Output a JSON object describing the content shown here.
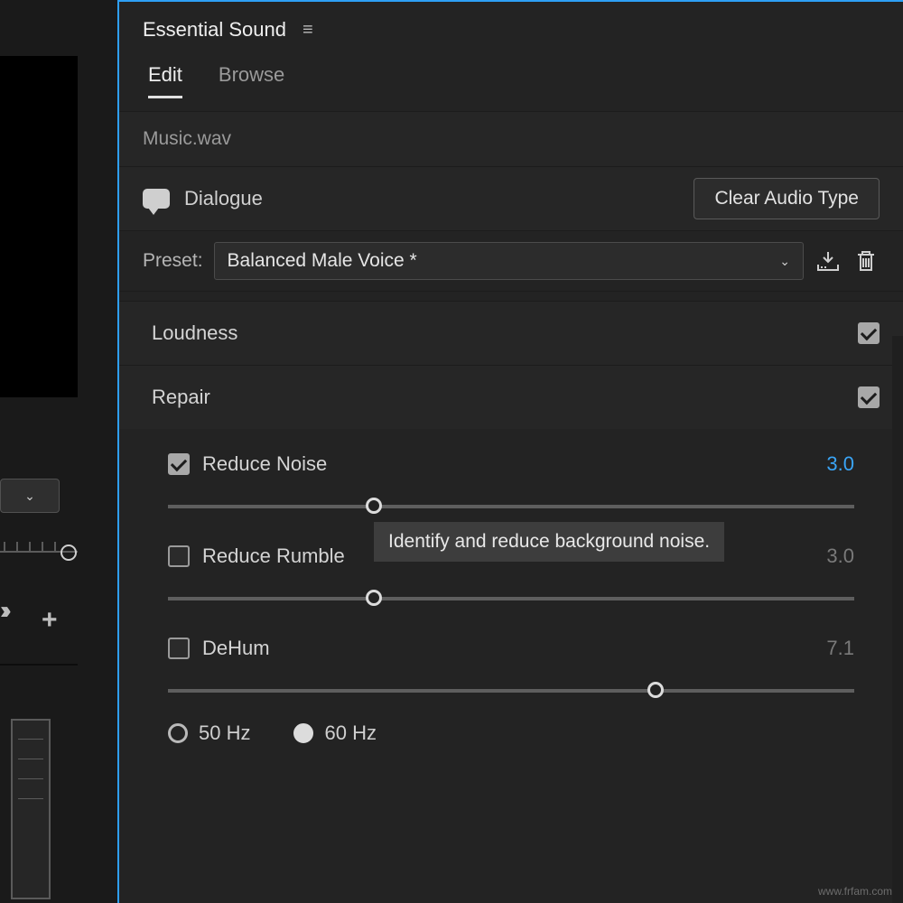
{
  "panel": {
    "title": "Essential Sound",
    "tabs": {
      "edit": "Edit",
      "browse": "Browse",
      "active": "edit"
    },
    "file": "Music.wav",
    "audio_type": {
      "label": "Dialogue",
      "clear_button": "Clear Audio Type"
    },
    "preset": {
      "label": "Preset:",
      "value": "Balanced Male Voice *"
    },
    "sections": {
      "loudness": {
        "title": "Loudness",
        "enabled": true
      },
      "repair": {
        "title": "Repair",
        "enabled": true,
        "reduce_noise": {
          "label": "Reduce Noise",
          "checked": true,
          "value": "3.0",
          "position": 30
        },
        "reduce_rumble": {
          "label": "Reduce Rumble",
          "checked": false,
          "value": "3.0",
          "position": 30
        },
        "dehum": {
          "label": "DeHum",
          "checked": false,
          "value": "7.1",
          "position": 71,
          "freq": {
            "opt_a": "50 Hz",
            "opt_b": "60 Hz",
            "selected": "60"
          }
        }
      }
    },
    "tooltip": "Identify and reduce background noise."
  },
  "watermark": "www.frfam.com"
}
